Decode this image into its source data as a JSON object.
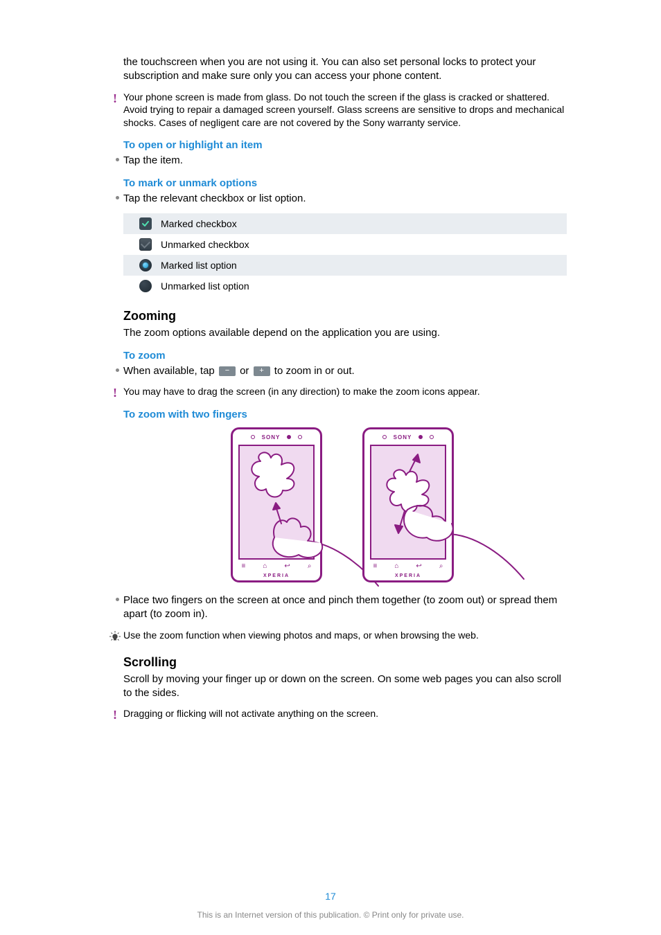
{
  "intro_paragraph": "the touchscreen when you are not using it. You can also set personal locks to protect your subscription and make sure only you can access your phone content.",
  "warning_glass": "Your phone screen is made from glass. Do not touch the screen if the glass is cracked or shattered. Avoid trying to repair a damaged screen yourself. Glass screens are sensitive to drops and mechanical shocks. Cases of negligent care are not covered by the Sony warranty service.",
  "heading_open": "To open or highlight an item",
  "bullet_tap_item": "Tap the item.",
  "heading_mark": "To mark or unmark options",
  "bullet_tap_checkbox": "Tap the relevant checkbox or list option.",
  "options": {
    "marked_checkbox": "Marked checkbox",
    "unmarked_checkbox": "Unmarked checkbox",
    "marked_list": "Marked list option",
    "unmarked_list": "Unmarked list option"
  },
  "section_zooming": "Zooming",
  "zooming_intro": "The zoom options available depend on the application you are using.",
  "heading_to_zoom": "To zoom",
  "zoom_bullet_pre": "When available, tap ",
  "zoom_bullet_mid": " or ",
  "zoom_bullet_post": " to zoom in or out.",
  "zoom_warning": "You may have to drag the screen (in any direction) to make the zoom icons appear.",
  "heading_two_fingers": "To zoom with two fingers",
  "phone_brand": "SONY",
  "phone_model": "XPERIA",
  "pinch_bullet": "Place two fingers on the screen at once and pinch them together (to zoom out) or spread them apart (to zoom in).",
  "tip_zoom": "Use the zoom function when viewing photos and maps, or when browsing the web.",
  "section_scrolling": "Scrolling",
  "scrolling_intro": "Scroll by moving your finger up or down on the screen. On some web pages you can also scroll to the sides.",
  "scroll_warning": "Dragging or flicking will not activate anything on the screen.",
  "page_number": "17",
  "disclaimer": "This is an Internet version of this publication. © Print only for private use."
}
